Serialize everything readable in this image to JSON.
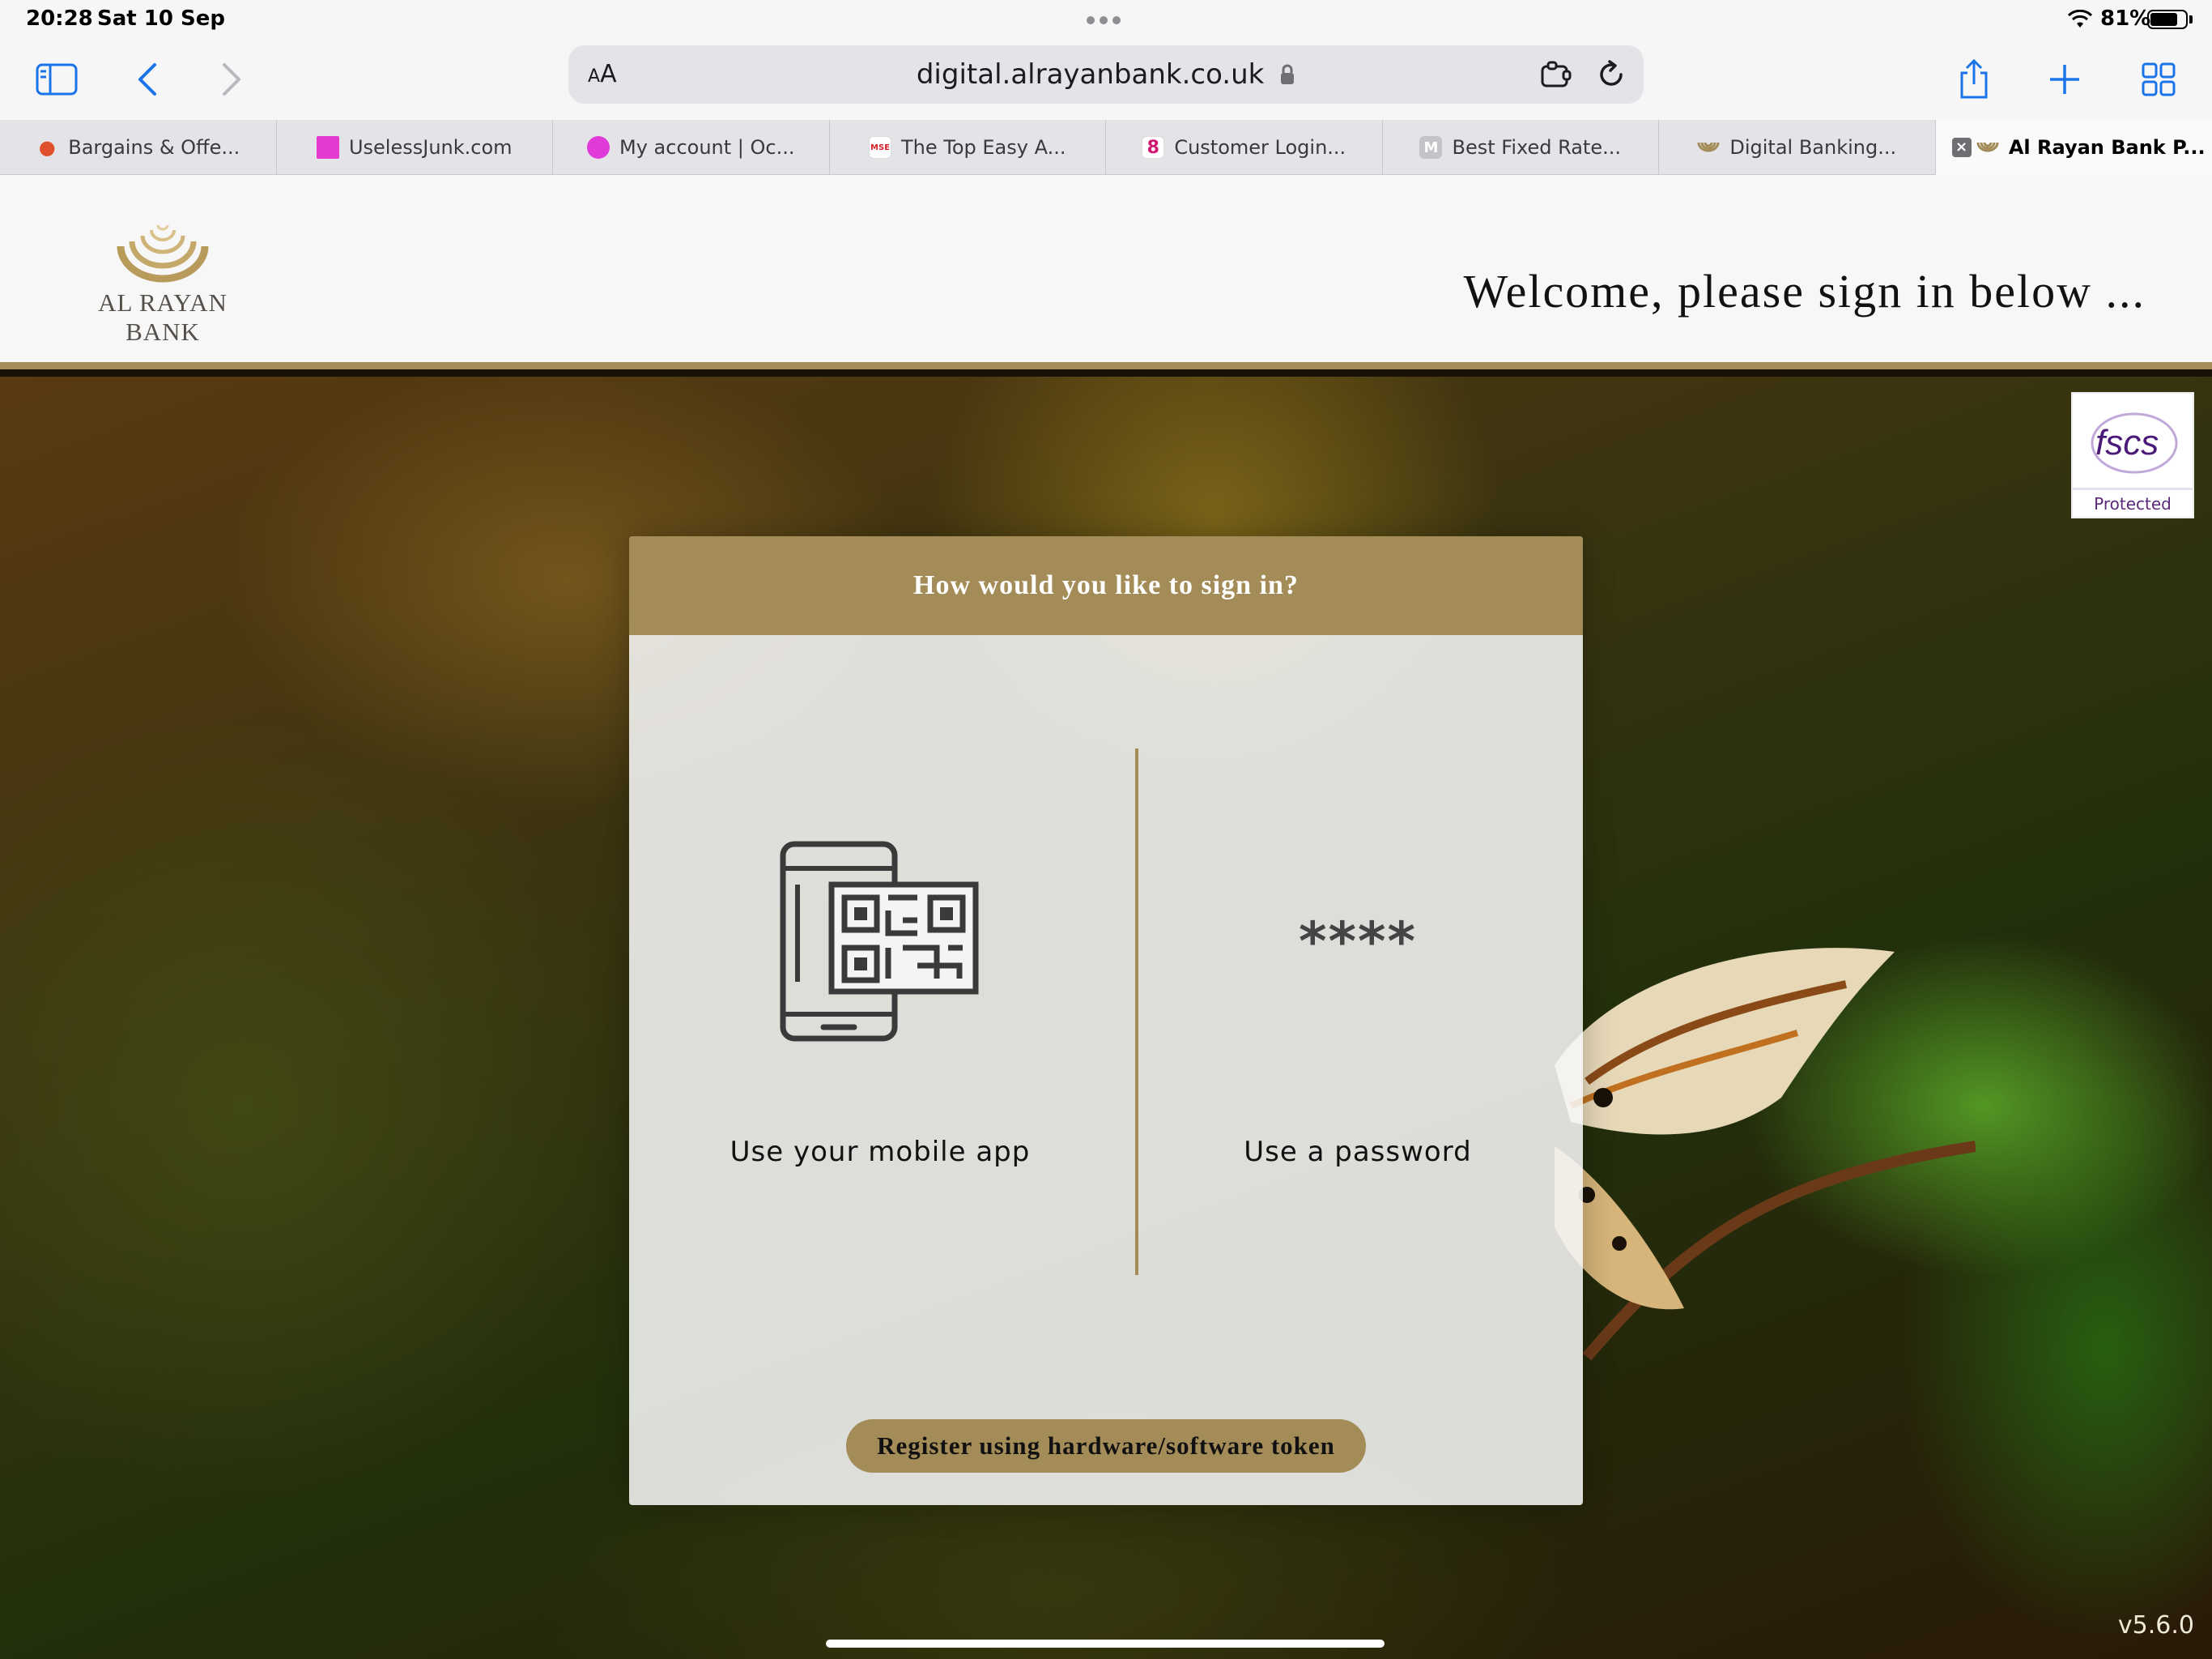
{
  "status_bar": {
    "time": "20:28",
    "date": "Sat 10 Sep",
    "battery": "81%"
  },
  "toolbar": {
    "text_size_label": "AA",
    "url": "digital.alrayanbank.co.uk"
  },
  "tabs": [
    {
      "title": "Bargains & Offe...",
      "favicon_color": "#e0502a"
    },
    {
      "title": "UselessJunk.com",
      "favicon_color": "#e53ad0"
    },
    {
      "title": "My account | Oc...",
      "favicon_color": "#e03ad8"
    },
    {
      "title": "The Top Easy A...",
      "favicon_text": "MSE",
      "favicon_color": "#d8222a"
    },
    {
      "title": "Customer Login...",
      "favicon_text": "8",
      "favicon_color": "#d0166e"
    },
    {
      "title": "Best Fixed Rate...",
      "favicon_text": "M",
      "favicon_color": "#b0b0b4"
    },
    {
      "title": "Digital Banking...",
      "favicon_color": "#a48c58"
    },
    {
      "title": "Al Rayan Bank P...",
      "favicon_color": "#a48c58",
      "active": true
    }
  ],
  "header": {
    "logo_text": "AL RAYAN BANK",
    "welcome": "Welcome, please sign in below ..."
  },
  "fscs": {
    "logo_text": "fscs",
    "label": "Protected"
  },
  "signin": {
    "heading": "How would you like to sign in?",
    "mobile_label": "Use your mobile app",
    "password_mask": "****",
    "password_label": "Use a password",
    "register_button": "Register using hardware/software token"
  },
  "version": "v5.6.0",
  "colors": {
    "brand_gold": "#a48c58",
    "safari_blue": "#1a73e8"
  }
}
